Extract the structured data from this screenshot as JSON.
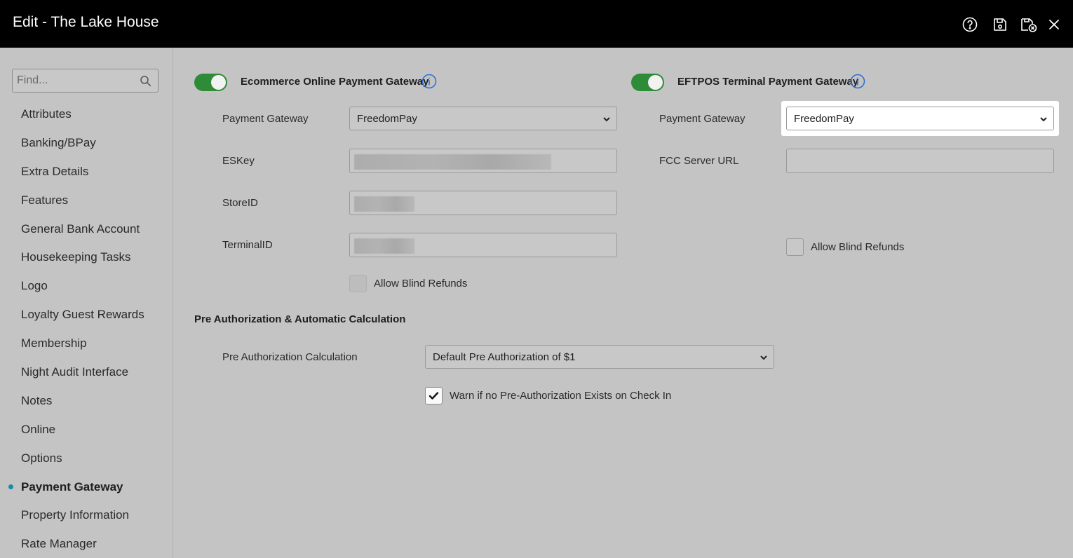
{
  "window": {
    "title": "Edit - The Lake House"
  },
  "toolbar": {
    "icons": [
      "help-icon",
      "save-icon",
      "save-and-close-icon",
      "close-icon"
    ]
  },
  "sidebar": {
    "search_placeholder": "Find...",
    "items": [
      {
        "label": "Attributes"
      },
      {
        "label": "Banking/BPay"
      },
      {
        "label": "Extra Details"
      },
      {
        "label": "Features"
      },
      {
        "label": "General Bank Account"
      },
      {
        "label": "Housekeeping Tasks"
      },
      {
        "label": "Logo"
      },
      {
        "label": "Loyalty Guest Rewards"
      },
      {
        "label": "Membership"
      },
      {
        "label": "Night Audit Interface"
      },
      {
        "label": "Notes"
      },
      {
        "label": "Online"
      },
      {
        "label": "Options"
      },
      {
        "label": "Payment Gateway",
        "active": true
      },
      {
        "label": "Property Information"
      },
      {
        "label": "Rate Manager"
      }
    ]
  },
  "ecommerce": {
    "title": "Ecommerce Online Payment Gateway",
    "enabled": true,
    "gateway_label": "Payment Gateway",
    "gateway_value": "FreedomPay",
    "eskey_label": "ESKey",
    "storeid_label": "StoreID",
    "terminalid_label": "TerminalID",
    "blind_refunds_label": "Allow Blind Refunds",
    "blind_refunds_checked": false
  },
  "eftpos": {
    "title": "EFTPOS Terminal Payment Gateway",
    "enabled": true,
    "gateway_label": "Payment Gateway",
    "gateway_value": "FreedomPay",
    "fcc_label": "FCC Server URL",
    "fcc_value": "",
    "blind_refunds_label": "Allow Blind Refunds",
    "blind_refunds_checked": false
  },
  "preauth": {
    "title": "Pre Authorization & Automatic Calculation",
    "calc_label": "Pre Authorization Calculation",
    "calc_value": "Default Pre Authorization of $1",
    "warn_label": "Warn if no Pre-Authorization Exists on Check In",
    "warn_checked": true
  },
  "colors": {
    "titlebar": "#000000",
    "background": "#c4c4c4",
    "toggle_on": "#2e8b38",
    "info_icon": "#2a6cd6",
    "active_dot": "#1a8aa8"
  }
}
